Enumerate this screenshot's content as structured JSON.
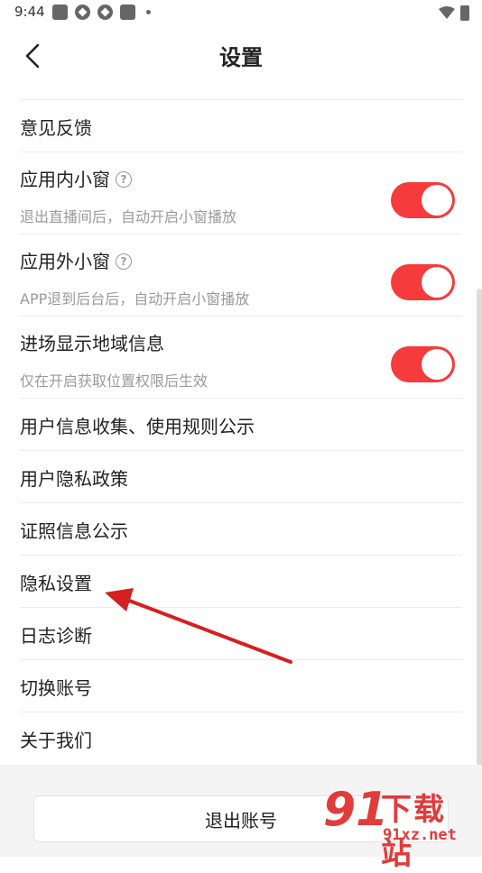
{
  "status_bar": {
    "time": "9:44"
  },
  "header": {
    "title": "设置"
  },
  "items": [
    {
      "title": "意见反馈"
    },
    {
      "title": "应用内小窗",
      "subtitle": "退出直播间后，自动开启小窗播放",
      "help": "?",
      "toggle_on": true
    },
    {
      "title": "应用外小窗",
      "subtitle": "APP退到后台后，自动开启小窗播放",
      "help": "?",
      "toggle_on": true
    },
    {
      "title": "进场显示地域信息",
      "subtitle": "仅在开启获取位置权限后生效",
      "toggle_on": true
    },
    {
      "title": "用户信息收集、使用规则公示"
    },
    {
      "title": "用户隐私政策"
    },
    {
      "title": "证照信息公示"
    },
    {
      "title": "隐私设置"
    },
    {
      "title": "日志诊断"
    },
    {
      "title": "切换账号"
    },
    {
      "title": "关于我们"
    }
  ],
  "footer": {
    "logout_label": "退出账号"
  },
  "watermark": {
    "logo": "91",
    "text": "下载站",
    "url": "91xz.net"
  },
  "colors": {
    "accent": "#f53b3b",
    "arrow": "#d42020"
  }
}
